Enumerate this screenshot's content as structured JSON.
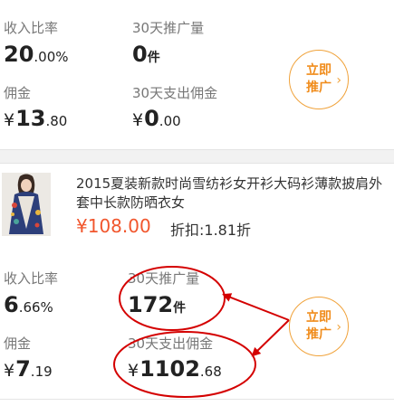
{
  "card1": {
    "income_ratio_label": "收入比率",
    "income_ratio_int": "20",
    "income_ratio_dec": ".00%",
    "promo_count_label": "30天推广量",
    "promo_count": "0",
    "promo_unit": "件",
    "commission_label": "佣金",
    "commission_currency": "¥",
    "commission_int": "13",
    "commission_dec": ".80",
    "spent_label": "30天支出佣金",
    "spent_currency": "¥",
    "spent_int": "0",
    "spent_dec": ".00",
    "promo_button": "立即推广"
  },
  "card2": {
    "product_title": "2015夏装新款时尚雪纺衫女开衫大码衫薄款披肩外套中长款防晒衣女",
    "price": "¥108.00",
    "discount": "折扣:1.81折",
    "income_ratio_label": "收入比率",
    "income_ratio_int": "6",
    "income_ratio_dec": ".66%",
    "promo_count_label": "30天推广量",
    "promo_count": "172",
    "promo_unit": "件",
    "commission_label": "佣金",
    "commission_currency": "¥",
    "commission_int": "7",
    "commission_dec": ".19",
    "spent_label": "30天支出佣金",
    "spent_currency": "¥",
    "spent_int": "1102",
    "spent_dec": ".68",
    "promo_button": "立即推广"
  },
  "colors": {
    "accent_orange": "#f08c1b",
    "price_red": "#f1562d",
    "annotation_red": "#d40000"
  },
  "icons": {
    "chevron": "chevron-right-icon"
  }
}
